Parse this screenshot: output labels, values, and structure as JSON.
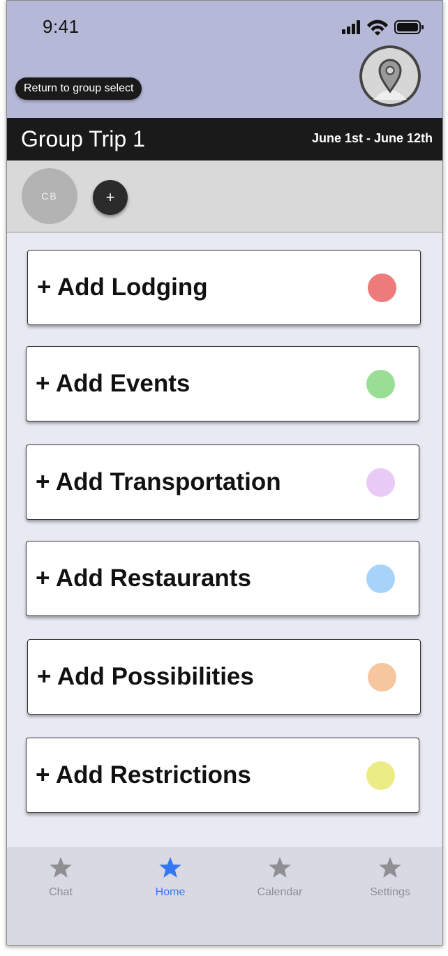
{
  "status_bar": {
    "time": "9:41"
  },
  "header": {
    "return_label": "Return to group select",
    "trip_title": "Group Trip 1",
    "trip_dates": "June 1st - June 12th",
    "profile_icon": "map-pin-avatar-icon"
  },
  "members": {
    "items": [
      {
        "initials": "CB"
      }
    ],
    "add_label": "+"
  },
  "cards": [
    {
      "label": "+ Add Lodging",
      "color": "#ed7b7b"
    },
    {
      "label": "+ Add Events",
      "color": "#9ade95"
    },
    {
      "label": "+ Add Transportation",
      "color": "#e9c9f5"
    },
    {
      "label": "+ Add Restaurants",
      "color": "#a7d3fa"
    },
    {
      "label": "+ Add Possibilities",
      "color": "#f6c79f"
    },
    {
      "label": "+ Add Restrictions",
      "color": "#ecec87"
    }
  ],
  "tabs": [
    {
      "label": "Chat",
      "icon": "star-icon",
      "active": false
    },
    {
      "label": "Home",
      "icon": "star-icon",
      "active": true
    },
    {
      "label": "Calendar",
      "icon": "star-icon",
      "active": false
    },
    {
      "label": "Settings",
      "icon": "star-icon",
      "active": false
    }
  ],
  "colors": {
    "header_bg": "#b5b8d6",
    "tab_active": "#3478f6",
    "tab_inactive": "#8e8e93"
  }
}
